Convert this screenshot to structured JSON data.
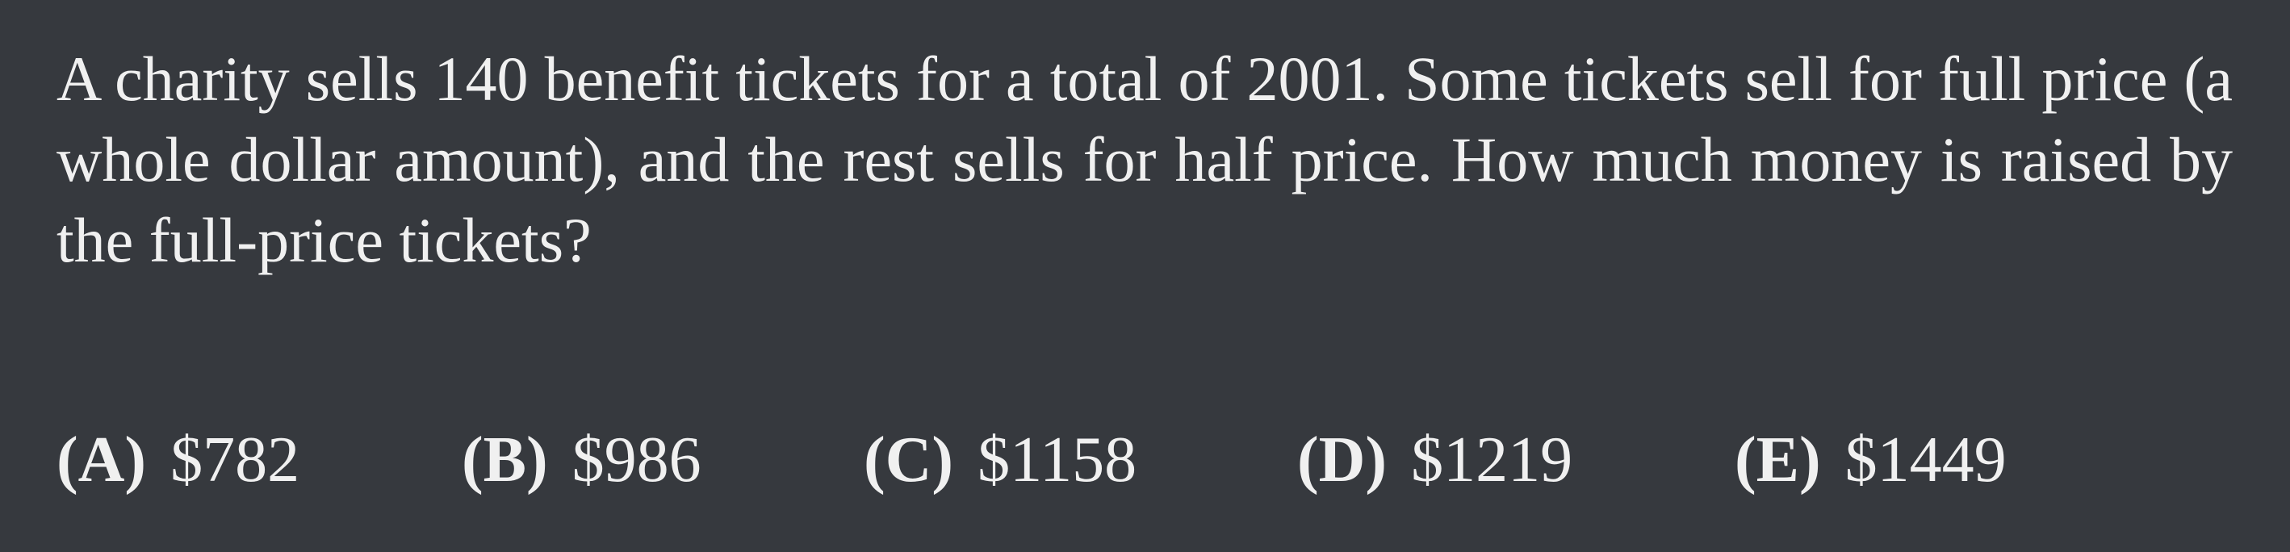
{
  "problem": {
    "text": "A charity sells 140 benefit tickets for a total of 2001. Some tickets sell for full price (a whole dollar amount), and the rest sells for half price. How much money is raised by the full-price tickets?"
  },
  "choices": [
    {
      "label": "(A)",
      "value": "$782"
    },
    {
      "label": "(B)",
      "value": "$986"
    },
    {
      "label": "(C)",
      "value": "$1158"
    },
    {
      "label": "(D)",
      "value": "$1219"
    },
    {
      "label": "(E)",
      "value": "$1449"
    }
  ],
  "colors": {
    "background": "#36393e",
    "text": "#f0f0f0"
  }
}
